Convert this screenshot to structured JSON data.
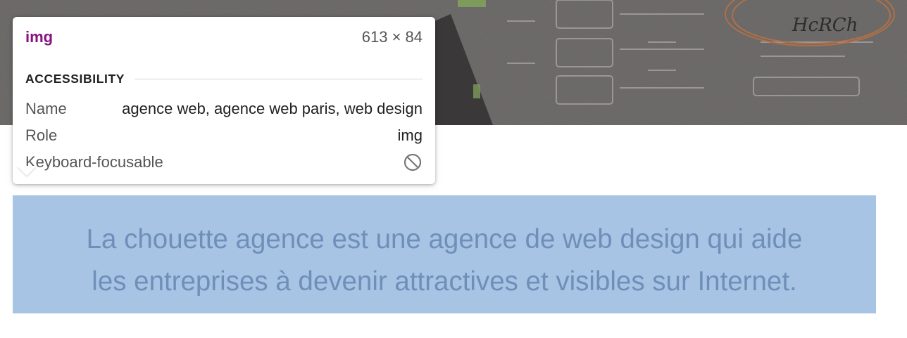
{
  "tooltip": {
    "tag": "img",
    "dimensions": "613 × 84",
    "section_title": "ACCESSIBILITY",
    "rows": [
      {
        "key": "Name",
        "value": "agence web, agence web paris, web design"
      },
      {
        "key": "Role",
        "value": "img"
      },
      {
        "key": "Keyboard-focusable",
        "value_icon": "not-allowed-icon"
      }
    ]
  },
  "hero": {
    "handwriting": "HcRCh"
  },
  "intro": {
    "line1": "La chouette agence est une agence de web design qui aide",
    "line2": "les entreprises à devenir attractives et visibles sur Internet."
  },
  "colors": {
    "tag": "#881280",
    "highlight": "#a7c4e5",
    "intro_text": "#6f8fb8"
  }
}
